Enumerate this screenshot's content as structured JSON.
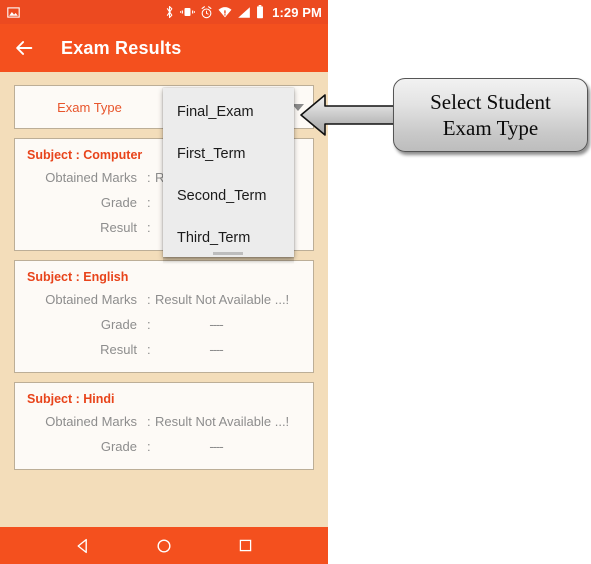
{
  "status_bar": {
    "icons": [
      "image-icon",
      "bluetooth-icon",
      "vibrate-icon",
      "alarm-icon",
      "wifi-icon",
      "signal-icon",
      "battery-icon"
    ],
    "time": "1:29 PM"
  },
  "app_bar": {
    "back_icon": "back-arrow-icon",
    "title": "Exam Results"
  },
  "spinner": {
    "label": "Exam Type",
    "selected": "",
    "caret_icon": "dropdown-caret-icon"
  },
  "dropdown": {
    "options": [
      "Final_Exam",
      "First_Term",
      "Second_Term",
      "Third_Term"
    ]
  },
  "cards": [
    {
      "title": "Subject : Computer",
      "rows": [
        {
          "label": "Obtained Marks",
          "colon": ":",
          "value": "Result Not Available ...!",
          "dash": false
        },
        {
          "label": "Grade",
          "colon": ":",
          "value": "----",
          "dash": true
        },
        {
          "label": "Result",
          "colon": ":",
          "value": "----",
          "dash": true
        }
      ]
    },
    {
      "title": "Subject : English",
      "rows": [
        {
          "label": "Obtained Marks",
          "colon": ":",
          "value": "Result Not Available ...!",
          "dash": false
        },
        {
          "label": "Grade",
          "colon": ":",
          "value": "----",
          "dash": true
        },
        {
          "label": "Result",
          "colon": ":",
          "value": "----",
          "dash": true
        }
      ]
    },
    {
      "title": "Subject : Hindi",
      "rows": [
        {
          "label": "Obtained Marks",
          "colon": ":",
          "value": "Result Not Available ...!",
          "dash": false
        },
        {
          "label": "Grade",
          "colon": ":",
          "value": "----",
          "dash": true
        }
      ]
    }
  ],
  "nav_bar": {
    "back_icon": "nav-back-triangle-icon",
    "home_icon": "nav-home-circle-icon",
    "recents_icon": "nav-recents-square-icon"
  },
  "annotation": {
    "arrow_icon": "callout-arrow-icon",
    "line1": "Select Student",
    "line2": "Exam Type"
  },
  "colors": {
    "status_bar": "#ec4a20",
    "app_bar": "#f4501e",
    "page_bg": "#f3ddba",
    "card_bg": "#fdfaf6",
    "card_border": "#bcae97",
    "accent_text": "#e8441b",
    "muted_text": "#8d8d8d",
    "dropdown_bg": "#ececec"
  }
}
